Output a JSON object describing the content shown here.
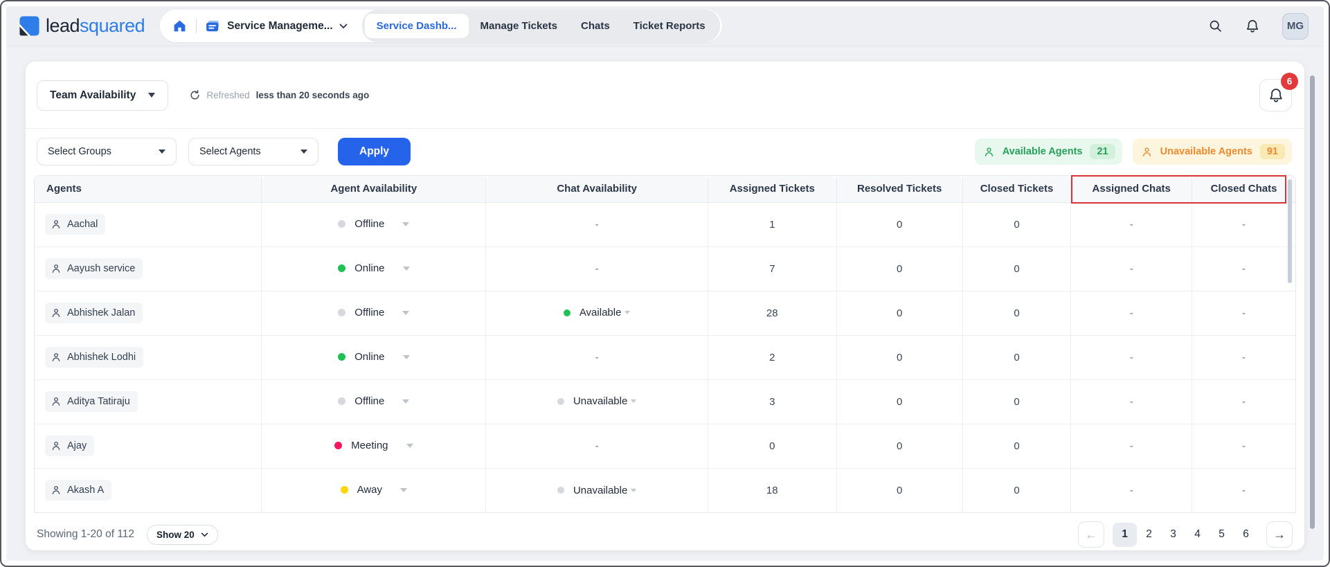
{
  "brand": {
    "logo_lead": "lead",
    "logo_squared": "squared"
  },
  "nav": {
    "workspace_label": "Service Manageme...",
    "tabs": [
      {
        "label": "Service Dashb...",
        "active": true
      },
      {
        "label": "Manage Tickets",
        "active": false
      },
      {
        "label": "Chats",
        "active": false
      },
      {
        "label": "Ticket Reports",
        "active": false
      }
    ],
    "user_initials": "MG"
  },
  "toolbar": {
    "view_selector": "Team Availability",
    "refreshed_label": "Refreshed",
    "refreshed_time": "less than 20 seconds ago",
    "notification_count": "6"
  },
  "filters": {
    "groups_placeholder": "Select Groups",
    "agents_placeholder": "Select Agents",
    "apply_label": "Apply",
    "available_label": "Available Agents",
    "available_count": "21",
    "unavailable_label": "Unavailable Agents",
    "unavailable_count": "91"
  },
  "table": {
    "columns": [
      "Agents",
      "Agent Availability",
      "Chat Availability",
      "Assigned Tickets",
      "Resolved Tickets",
      "Closed Tickets",
      "Assigned Chats",
      "Closed Chats"
    ],
    "empty_value": "-",
    "status_colors": {
      "Online": "#1fc155",
      "Offline": "#d5d9df",
      "Meeting": "#f7175e",
      "Away": "#ffd60a",
      "Available": "#1fc155",
      "Unavailable": "#d5d9df"
    },
    "rows": [
      {
        "name": "Aachal",
        "agent_status": "Offline",
        "chat_status": null,
        "assigned_tickets": "1",
        "resolved_tickets": "0",
        "closed_tickets": "0",
        "assigned_chats": "-",
        "closed_chats": "-"
      },
      {
        "name": "Aayush service",
        "agent_status": "Online",
        "chat_status": null,
        "assigned_tickets": "7",
        "resolved_tickets": "0",
        "closed_tickets": "0",
        "assigned_chats": "-",
        "closed_chats": "-"
      },
      {
        "name": "Abhishek Jalan",
        "agent_status": "Offline",
        "chat_status": "Available",
        "assigned_tickets": "28",
        "resolved_tickets": "0",
        "closed_tickets": "0",
        "assigned_chats": "-",
        "closed_chats": "-"
      },
      {
        "name": "Abhishek Lodhi",
        "agent_status": "Online",
        "chat_status": null,
        "assigned_tickets": "2",
        "resolved_tickets": "0",
        "closed_tickets": "0",
        "assigned_chats": "-",
        "closed_chats": "-"
      },
      {
        "name": "Aditya Tatiraju",
        "agent_status": "Offline",
        "chat_status": "Unavailable",
        "assigned_tickets": "3",
        "resolved_tickets": "0",
        "closed_tickets": "0",
        "assigned_chats": "-",
        "closed_chats": "-"
      },
      {
        "name": "Ajay",
        "agent_status": "Meeting",
        "chat_status": null,
        "assigned_tickets": "0",
        "resolved_tickets": "0",
        "closed_tickets": "0",
        "assigned_chats": "-",
        "closed_chats": "-"
      },
      {
        "name": "Akash A",
        "agent_status": "Away",
        "chat_status": "Unavailable",
        "assigned_tickets": "18",
        "resolved_tickets": "0",
        "closed_tickets": "0",
        "assigned_chats": "-",
        "closed_chats": "-"
      }
    ]
  },
  "footer": {
    "showing": "Showing 1-20 of 112",
    "page_size_label": "Show 20",
    "pages": [
      "1",
      "2",
      "3",
      "4",
      "5",
      "6"
    ],
    "active_page": "1"
  },
  "icons": {
    "arrow_left": "←",
    "arrow_right": "→"
  },
  "colors": {
    "accent": "#2563eb",
    "active_tab_text": "#2a6ae0",
    "green": "#27a05c",
    "orange": "#ee8a2f",
    "badge_red": "#e23a3c",
    "annotation_red": "#d93434"
  }
}
